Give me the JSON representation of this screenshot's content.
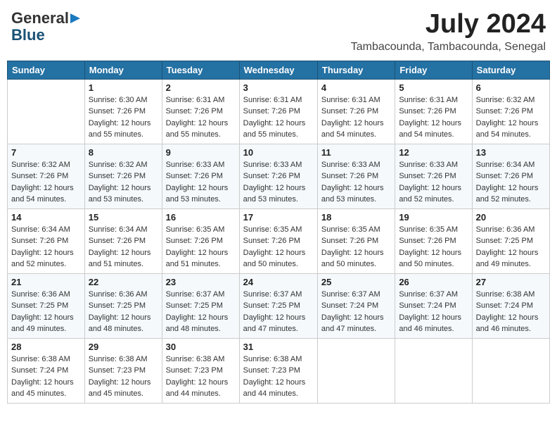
{
  "header": {
    "logo_general": "General",
    "logo_blue": "Blue",
    "month_year": "July 2024",
    "location": "Tambacounda, Tambacounda, Senegal"
  },
  "days_of_week": [
    "Sunday",
    "Monday",
    "Tuesday",
    "Wednesday",
    "Thursday",
    "Friday",
    "Saturday"
  ],
  "weeks": [
    [
      {
        "day": "",
        "sunrise": "",
        "sunset": "",
        "daylight": ""
      },
      {
        "day": "1",
        "sunrise": "Sunrise: 6:30 AM",
        "sunset": "Sunset: 7:26 PM",
        "daylight": "Daylight: 12 hours and 55 minutes."
      },
      {
        "day": "2",
        "sunrise": "Sunrise: 6:31 AM",
        "sunset": "Sunset: 7:26 PM",
        "daylight": "Daylight: 12 hours and 55 minutes."
      },
      {
        "day": "3",
        "sunrise": "Sunrise: 6:31 AM",
        "sunset": "Sunset: 7:26 PM",
        "daylight": "Daylight: 12 hours and 55 minutes."
      },
      {
        "day": "4",
        "sunrise": "Sunrise: 6:31 AM",
        "sunset": "Sunset: 7:26 PM",
        "daylight": "Daylight: 12 hours and 54 minutes."
      },
      {
        "day": "5",
        "sunrise": "Sunrise: 6:31 AM",
        "sunset": "Sunset: 7:26 PM",
        "daylight": "Daylight: 12 hours and 54 minutes."
      },
      {
        "day": "6",
        "sunrise": "Sunrise: 6:32 AM",
        "sunset": "Sunset: 7:26 PM",
        "daylight": "Daylight: 12 hours and 54 minutes."
      }
    ],
    [
      {
        "day": "7",
        "sunrise": "Sunrise: 6:32 AM",
        "sunset": "Sunset: 7:26 PM",
        "daylight": "Daylight: 12 hours and 54 minutes."
      },
      {
        "day": "8",
        "sunrise": "Sunrise: 6:32 AM",
        "sunset": "Sunset: 7:26 PM",
        "daylight": "Daylight: 12 hours and 53 minutes."
      },
      {
        "day": "9",
        "sunrise": "Sunrise: 6:33 AM",
        "sunset": "Sunset: 7:26 PM",
        "daylight": "Daylight: 12 hours and 53 minutes."
      },
      {
        "day": "10",
        "sunrise": "Sunrise: 6:33 AM",
        "sunset": "Sunset: 7:26 PM",
        "daylight": "Daylight: 12 hours and 53 minutes."
      },
      {
        "day": "11",
        "sunrise": "Sunrise: 6:33 AM",
        "sunset": "Sunset: 7:26 PM",
        "daylight": "Daylight: 12 hours and 53 minutes."
      },
      {
        "day": "12",
        "sunrise": "Sunrise: 6:33 AM",
        "sunset": "Sunset: 7:26 PM",
        "daylight": "Daylight: 12 hours and 52 minutes."
      },
      {
        "day": "13",
        "sunrise": "Sunrise: 6:34 AM",
        "sunset": "Sunset: 7:26 PM",
        "daylight": "Daylight: 12 hours and 52 minutes."
      }
    ],
    [
      {
        "day": "14",
        "sunrise": "Sunrise: 6:34 AM",
        "sunset": "Sunset: 7:26 PM",
        "daylight": "Daylight: 12 hours and 52 minutes."
      },
      {
        "day": "15",
        "sunrise": "Sunrise: 6:34 AM",
        "sunset": "Sunset: 7:26 PM",
        "daylight": "Daylight: 12 hours and 51 minutes."
      },
      {
        "day": "16",
        "sunrise": "Sunrise: 6:35 AM",
        "sunset": "Sunset: 7:26 PM",
        "daylight": "Daylight: 12 hours and 51 minutes."
      },
      {
        "day": "17",
        "sunrise": "Sunrise: 6:35 AM",
        "sunset": "Sunset: 7:26 PM",
        "daylight": "Daylight: 12 hours and 50 minutes."
      },
      {
        "day": "18",
        "sunrise": "Sunrise: 6:35 AM",
        "sunset": "Sunset: 7:26 PM",
        "daylight": "Daylight: 12 hours and 50 minutes."
      },
      {
        "day": "19",
        "sunrise": "Sunrise: 6:35 AM",
        "sunset": "Sunset: 7:26 PM",
        "daylight": "Daylight: 12 hours and 50 minutes."
      },
      {
        "day": "20",
        "sunrise": "Sunrise: 6:36 AM",
        "sunset": "Sunset: 7:25 PM",
        "daylight": "Daylight: 12 hours and 49 minutes."
      }
    ],
    [
      {
        "day": "21",
        "sunrise": "Sunrise: 6:36 AM",
        "sunset": "Sunset: 7:25 PM",
        "daylight": "Daylight: 12 hours and 49 minutes."
      },
      {
        "day": "22",
        "sunrise": "Sunrise: 6:36 AM",
        "sunset": "Sunset: 7:25 PM",
        "daylight": "Daylight: 12 hours and 48 minutes."
      },
      {
        "day": "23",
        "sunrise": "Sunrise: 6:37 AM",
        "sunset": "Sunset: 7:25 PM",
        "daylight": "Daylight: 12 hours and 48 minutes."
      },
      {
        "day": "24",
        "sunrise": "Sunrise: 6:37 AM",
        "sunset": "Sunset: 7:25 PM",
        "daylight": "Daylight: 12 hours and 47 minutes."
      },
      {
        "day": "25",
        "sunrise": "Sunrise: 6:37 AM",
        "sunset": "Sunset: 7:24 PM",
        "daylight": "Daylight: 12 hours and 47 minutes."
      },
      {
        "day": "26",
        "sunrise": "Sunrise: 6:37 AM",
        "sunset": "Sunset: 7:24 PM",
        "daylight": "Daylight: 12 hours and 46 minutes."
      },
      {
        "day": "27",
        "sunrise": "Sunrise: 6:38 AM",
        "sunset": "Sunset: 7:24 PM",
        "daylight": "Daylight: 12 hours and 46 minutes."
      }
    ],
    [
      {
        "day": "28",
        "sunrise": "Sunrise: 6:38 AM",
        "sunset": "Sunset: 7:24 PM",
        "daylight": "Daylight: 12 hours and 45 minutes."
      },
      {
        "day": "29",
        "sunrise": "Sunrise: 6:38 AM",
        "sunset": "Sunset: 7:23 PM",
        "daylight": "Daylight: 12 hours and 45 minutes."
      },
      {
        "day": "30",
        "sunrise": "Sunrise: 6:38 AM",
        "sunset": "Sunset: 7:23 PM",
        "daylight": "Daylight: 12 hours and 44 minutes."
      },
      {
        "day": "31",
        "sunrise": "Sunrise: 6:38 AM",
        "sunset": "Sunset: 7:23 PM",
        "daylight": "Daylight: 12 hours and 44 minutes."
      },
      {
        "day": "",
        "sunrise": "",
        "sunset": "",
        "daylight": ""
      },
      {
        "day": "",
        "sunrise": "",
        "sunset": "",
        "daylight": ""
      },
      {
        "day": "",
        "sunrise": "",
        "sunset": "",
        "daylight": ""
      }
    ]
  ]
}
